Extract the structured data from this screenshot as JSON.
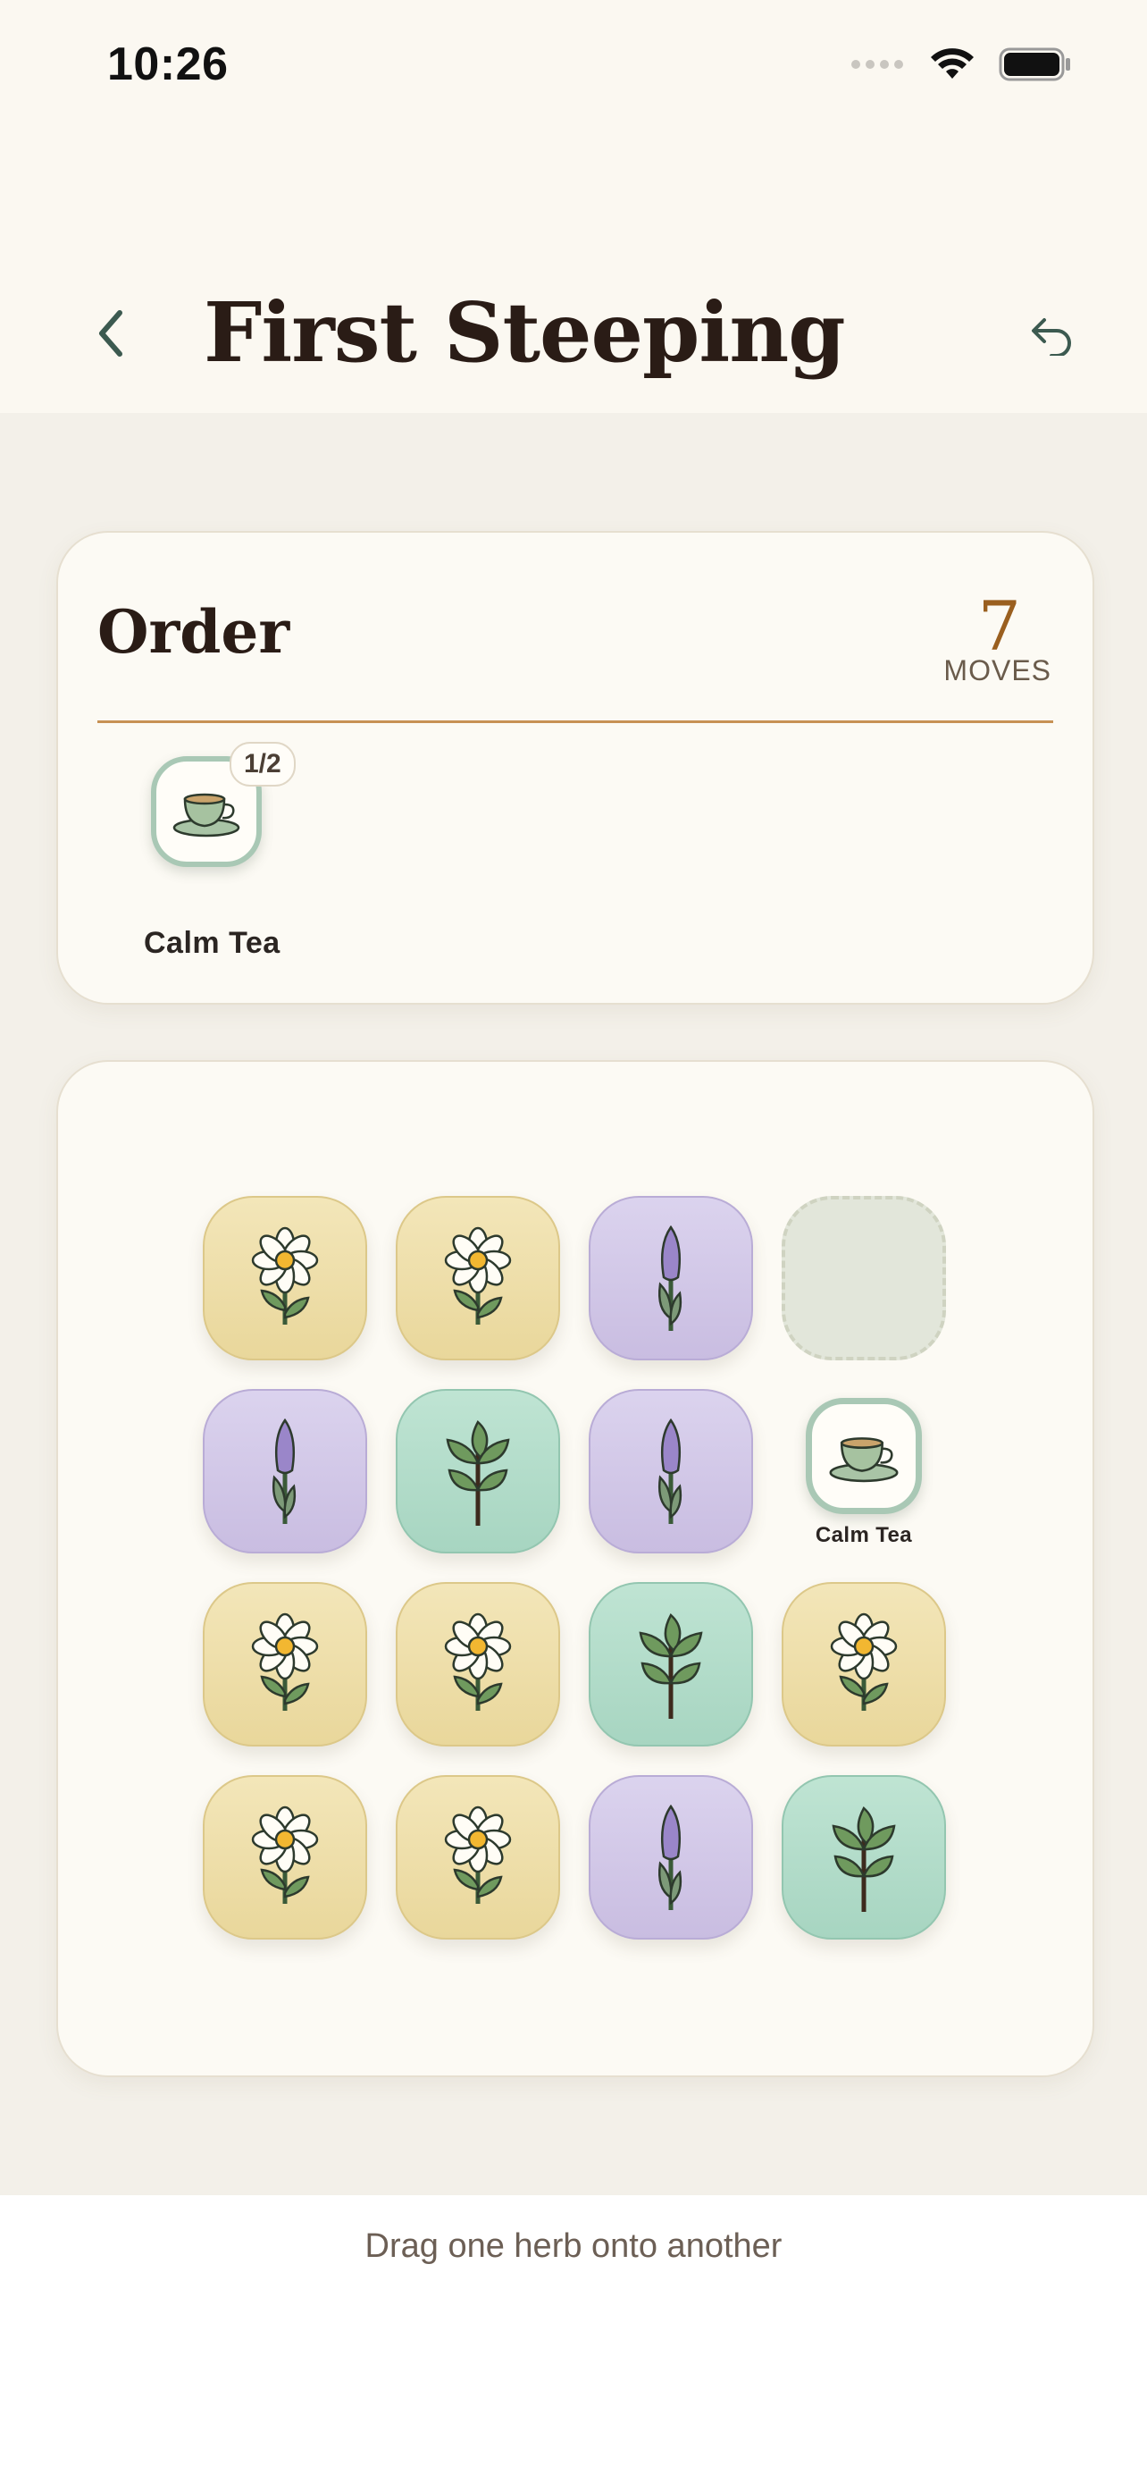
{
  "status_bar": {
    "time": "10:26",
    "icons": [
      "signal-icon",
      "wifi-icon",
      "battery-icon"
    ]
  },
  "header": {
    "title": "First Steeping",
    "back_icon": "chevron-left-icon",
    "undo_icon": "undo-icon"
  },
  "order": {
    "title": "Order",
    "moves_count": "7",
    "moves_label": "MOVES",
    "items": [
      {
        "name": "Calm Tea",
        "progress": "1/2",
        "icon": "teacup-icon"
      }
    ]
  },
  "board": {
    "rows": [
      [
        {
          "kind": "chamomile",
          "icon": "chamomile-icon"
        },
        {
          "kind": "chamomile",
          "icon": "chamomile-icon"
        },
        {
          "kind": "lavender",
          "icon": "lavender-icon"
        },
        {
          "kind": "empty"
        }
      ],
      [
        {
          "kind": "lavender",
          "icon": "lavender-icon"
        },
        {
          "kind": "mint",
          "icon": "mint-icon"
        },
        {
          "kind": "lavender",
          "icon": "lavender-icon"
        },
        {
          "kind": "product",
          "icon": "teacup-icon",
          "label": "Calm Tea"
        }
      ],
      [
        {
          "kind": "chamomile",
          "icon": "chamomile-icon"
        },
        {
          "kind": "chamomile",
          "icon": "chamomile-icon"
        },
        {
          "kind": "mint",
          "icon": "mint-icon"
        },
        {
          "kind": "chamomile",
          "icon": "chamomile-icon"
        }
      ],
      [
        {
          "kind": "chamomile",
          "icon": "chamomile-icon"
        },
        {
          "kind": "chamomile",
          "icon": "chamomile-icon"
        },
        {
          "kind": "lavender",
          "icon": "lavender-icon"
        },
        {
          "kind": "mint",
          "icon": "mint-icon"
        }
      ]
    ]
  },
  "hint": "Drag one herb onto another",
  "colors": {
    "accent": "#9a5f1f",
    "header_text": "#2a1c16",
    "rule": "#c79154"
  }
}
